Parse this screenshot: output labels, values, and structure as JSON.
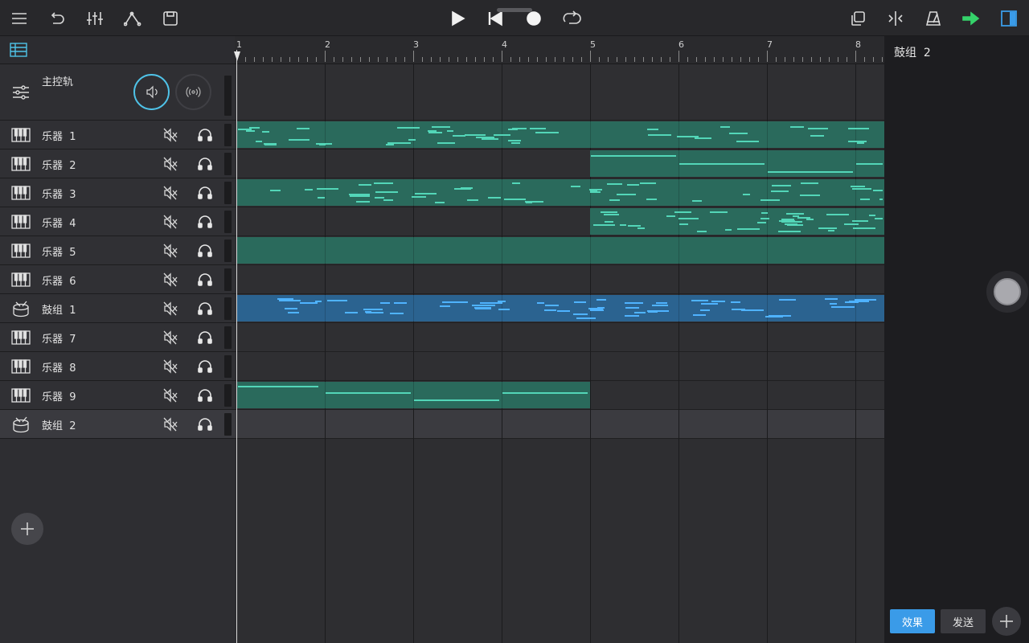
{
  "toolbar": {
    "left_icons": [
      "menu-icon",
      "undo-icon",
      "mixer-icon",
      "automation-icon",
      "save-icon"
    ],
    "transport_icons": [
      "play-icon",
      "rewind-icon",
      "record-icon",
      "loop-icon"
    ],
    "right_icons": [
      "duplicate-icon",
      "split-icon",
      "metronome-icon",
      "export-icon",
      "panel-toggle-icon"
    ],
    "colors": {
      "export": "#35d36a",
      "panel_toggle": "#3a9be8",
      "accent": "#4fc3e8"
    }
  },
  "ruler": {
    "bars": [
      "1",
      "2",
      "3",
      "4",
      "5",
      "6",
      "7",
      "8"
    ]
  },
  "master": {
    "label": "主控轨"
  },
  "tracks": [
    {
      "name": "乐器  1",
      "type": "instrument"
    },
    {
      "name": "乐器  2",
      "type": "instrument"
    },
    {
      "name": "乐器  3",
      "type": "instrument"
    },
    {
      "name": "乐器  4",
      "type": "instrument"
    },
    {
      "name": "乐器  5",
      "type": "instrument"
    },
    {
      "name": "乐器  6",
      "type": "instrument"
    },
    {
      "name": "鼓组  1",
      "type": "drum"
    },
    {
      "name": "乐器  7",
      "type": "instrument"
    },
    {
      "name": "乐器  8",
      "type": "instrument"
    },
    {
      "name": "乐器  9",
      "type": "instrument"
    },
    {
      "name": "鼓组  2",
      "type": "drum",
      "selected": true
    }
  ],
  "right_panel": {
    "title": "鼓组  2",
    "effects_label": "效果",
    "send_label": "发送"
  },
  "colors": {
    "region_green": "#2a6a5c",
    "region_blue": "#2b6390",
    "note_green": "#53d6b8",
    "note_blue": "#4fb3ff"
  }
}
